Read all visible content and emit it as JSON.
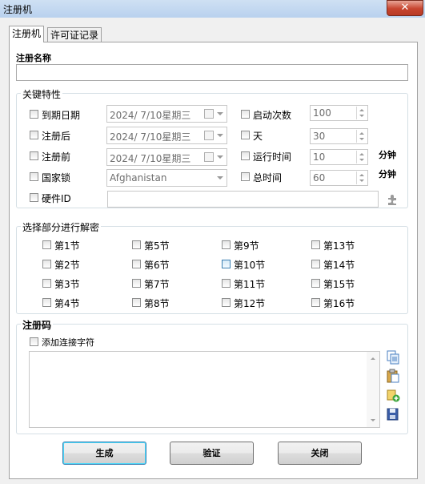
{
  "window": {
    "title": "注册机",
    "close": "✕"
  },
  "tabs": [
    {
      "label": "注册机"
    },
    {
      "label": "许可证记录"
    }
  ],
  "reg_name": {
    "label": "注册名称",
    "value": ""
  },
  "key_features": {
    "title": "关键特性",
    "expiry_date": {
      "label": "到期日期",
      "date": "2024/  7/10星期三",
      "checked": false
    },
    "after": {
      "label": "注册后",
      "date": "2024/  7/10星期三",
      "checked": false
    },
    "before": {
      "label": "注册前",
      "date": "2024/  7/10星期三",
      "checked": false
    },
    "country": {
      "label": "国家锁",
      "value": "Afghanistan",
      "checked": false
    },
    "hardware_id": {
      "label": "硬件ID",
      "value": "",
      "checked": false
    },
    "launch_count": {
      "label": "启动次数",
      "value": "100",
      "checked": false
    },
    "days": {
      "label": "天",
      "value": "30",
      "checked": false
    },
    "run_time": {
      "label": "运行时间",
      "value": "10",
      "unit": "分钟",
      "checked": false
    },
    "total_time": {
      "label": "总时间",
      "value": "60",
      "unit": "分钟",
      "checked": false
    }
  },
  "sections": {
    "title": "选择部分进行解密",
    "items": [
      "第1节",
      "第2节",
      "第3节",
      "第4节",
      "第5节",
      "第6节",
      "第7节",
      "第8节",
      "第9节",
      "第10节",
      "第11节",
      "第12节",
      "第13节",
      "第14节",
      "第15节",
      "第16节"
    ]
  },
  "reg_code": {
    "title": "注册码",
    "add_hyphen_label": "添加连接字符",
    "value": ""
  },
  "buttons": {
    "generate": "生成",
    "verify": "验证",
    "close": "关闭"
  },
  "icons": {
    "copy": "copy-icon",
    "paste": "paste-icon",
    "add": "add-key-icon",
    "save": "save-icon",
    "hardware": "puzzle-icon"
  }
}
